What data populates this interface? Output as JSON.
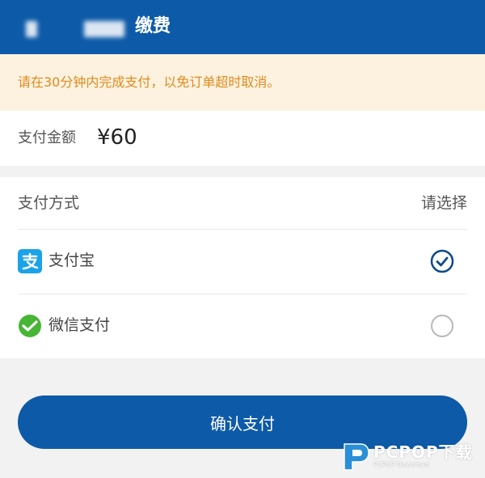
{
  "header": {
    "title": "缴费"
  },
  "notice": {
    "text": "请在30分钟内完成支付，以免订单超时取消。"
  },
  "amount": {
    "label": "支付金额",
    "value": "¥60"
  },
  "methods": {
    "label": "支付方式",
    "hint": "请选择",
    "options": [
      {
        "name": "支付宝",
        "icon": "alipay-icon",
        "selected": true
      },
      {
        "name": "微信支付",
        "icon": "wechat-pay-icon",
        "selected": false
      }
    ]
  },
  "confirm_button": {
    "label": "确认支付"
  },
  "watermark": {
    "brand": "PCPOP下载",
    "sub": "PCPOP Download"
  },
  "colors": {
    "primary": "#0d5aa8",
    "warning_text": "#e08a1d",
    "notice_bg": "#fcf2df",
    "alipay": "#1aa3e8",
    "wechat": "#47b535"
  }
}
